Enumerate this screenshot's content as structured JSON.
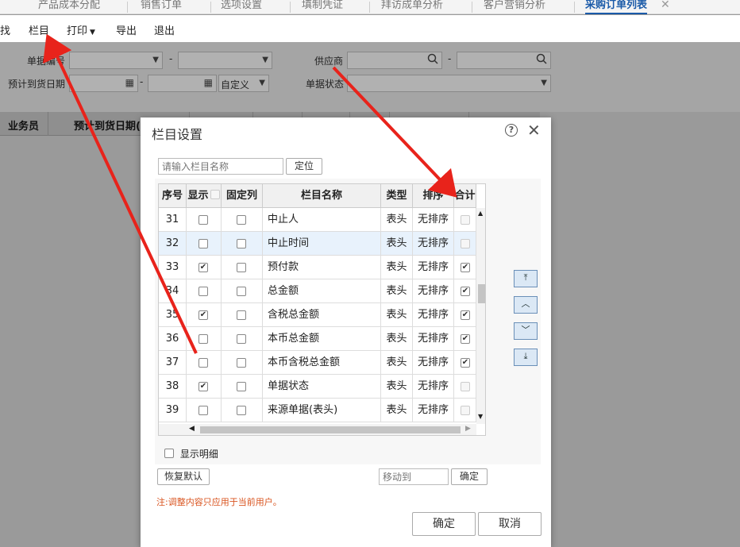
{
  "tabs": [
    {
      "label": "产品成本分配"
    },
    {
      "label": "销售订单"
    },
    {
      "label": "选项设置"
    },
    {
      "label": "填制凭证"
    },
    {
      "label": "拜访成单分析"
    },
    {
      "label": "客户营销分析"
    },
    {
      "label": "采购订单列表",
      "close": "✕"
    }
  ],
  "toolbar": {
    "find": "查找",
    "columns": "栏目",
    "print": "打印",
    "export": "导出",
    "exit": "退出"
  },
  "filter": {
    "doc_no_label": "单据编号",
    "dash": "-",
    "supplier_label": "供应商",
    "expected_date_label": "预计到货日期",
    "custom_option": "自定义",
    "doc_status_label": "单据状态"
  },
  "grid_headers": [
    "业务员",
    "预计到货日期(表头)"
  ],
  "dialog": {
    "title": "栏目设置",
    "search_placeholder": "请输入栏目名称",
    "locate_button": "定位",
    "headers": {
      "seq": "序号",
      "show": "显示",
      "fixed": "固定列",
      "name": "栏目名称",
      "type": "类型",
      "sort": "排序",
      "total": "合计"
    },
    "rows": [
      {
        "seq": "31",
        "show": false,
        "fixed": false,
        "name": "中止人",
        "type": "表头",
        "sort": "无排序",
        "total": false,
        "total_disabled": true
      },
      {
        "seq": "32",
        "show": false,
        "fixed": false,
        "name": "中止时间",
        "type": "表头",
        "sort": "无排序",
        "total": false,
        "total_disabled": true
      },
      {
        "seq": "33",
        "show": true,
        "fixed": false,
        "name": "预付款",
        "type": "表头",
        "sort": "无排序",
        "total": true,
        "total_disabled": false
      },
      {
        "seq": "34",
        "show": false,
        "fixed": false,
        "name": "总金额",
        "type": "表头",
        "sort": "无排序",
        "total": true,
        "total_disabled": false
      },
      {
        "seq": "35",
        "show": true,
        "fixed": false,
        "name": "含税总金额",
        "type": "表头",
        "sort": "无排序",
        "total": true,
        "total_disabled": false
      },
      {
        "seq": "36",
        "show": false,
        "fixed": false,
        "name": "本币总金额",
        "type": "表头",
        "sort": "无排序",
        "total": true,
        "total_disabled": false
      },
      {
        "seq": "37",
        "show": false,
        "fixed": false,
        "name": "本币含税总金额",
        "type": "表头",
        "sort": "无排序",
        "total": true,
        "total_disabled": false
      },
      {
        "seq": "38",
        "show": true,
        "fixed": false,
        "name": "单据状态",
        "type": "表头",
        "sort": "无排序",
        "total": false,
        "total_disabled": true
      },
      {
        "seq": "39",
        "show": false,
        "fixed": false,
        "name": "来源单据(表头)",
        "type": "表头",
        "sort": "无排序",
        "total": false,
        "total_disabled": true
      }
    ],
    "show_detail": "显示明细",
    "restore_button": "恢复默认",
    "move_to_placeholder": "移动到",
    "move_confirm": "确定",
    "note": "注:调整内容只应用于当前用户。",
    "ok_button": "确定",
    "cancel_button": "取消"
  },
  "colors": {
    "accent": "#1a5aa8",
    "arrow": "#e8231b",
    "note": "#d9531e"
  }
}
